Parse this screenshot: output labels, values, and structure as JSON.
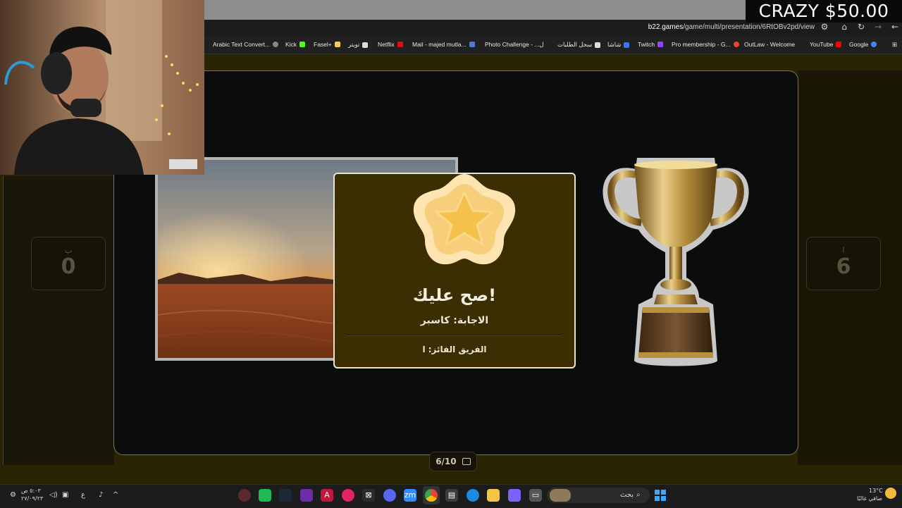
{
  "donation_overlay": {
    "text": "CRAZY $50.00"
  },
  "browser": {
    "url_domain": "b22.games",
    "url_path": "/game/multi/presentation/6RtOBv2pd/view",
    "bookmarks": [
      "Arabic Text Convert...",
      "Kick",
      "Fasel+",
      "تويتر",
      "Netflix",
      "Mail - majed mutla...",
      "Photo Challenge - ...ل",
      "سجل الطلبات",
      "شاشا",
      "Twitch",
      "Pro membership - G...",
      "OutLaw - Welcome",
      "YouTube",
      "Google"
    ]
  },
  "game": {
    "team_left": {
      "label": "ب",
      "score": "0"
    },
    "team_right": {
      "label": "ا",
      "score": "6"
    },
    "result_title": "صح عليك!",
    "answer_text": "الاجابة: كاسبر",
    "winner_text": "الفريق الفائز: ا",
    "question_counter": "6/10"
  },
  "taskbar": {
    "time": "٥:٠٣ ص",
    "date": "٢٧/٠٩/٢٣",
    "lang": "ع",
    "search_placeholder": "بحث",
    "weather_temp": "13°C",
    "weather_desc": "صافي غالبًا"
  },
  "colors": {
    "accent": "#3a2e02",
    "star": "#f7c356",
    "trophy": "#c9a45a"
  },
  "icons": [
    "star-icon",
    "trophy-icon",
    "image-icon",
    "windows-start-icon",
    "search-icon"
  ]
}
